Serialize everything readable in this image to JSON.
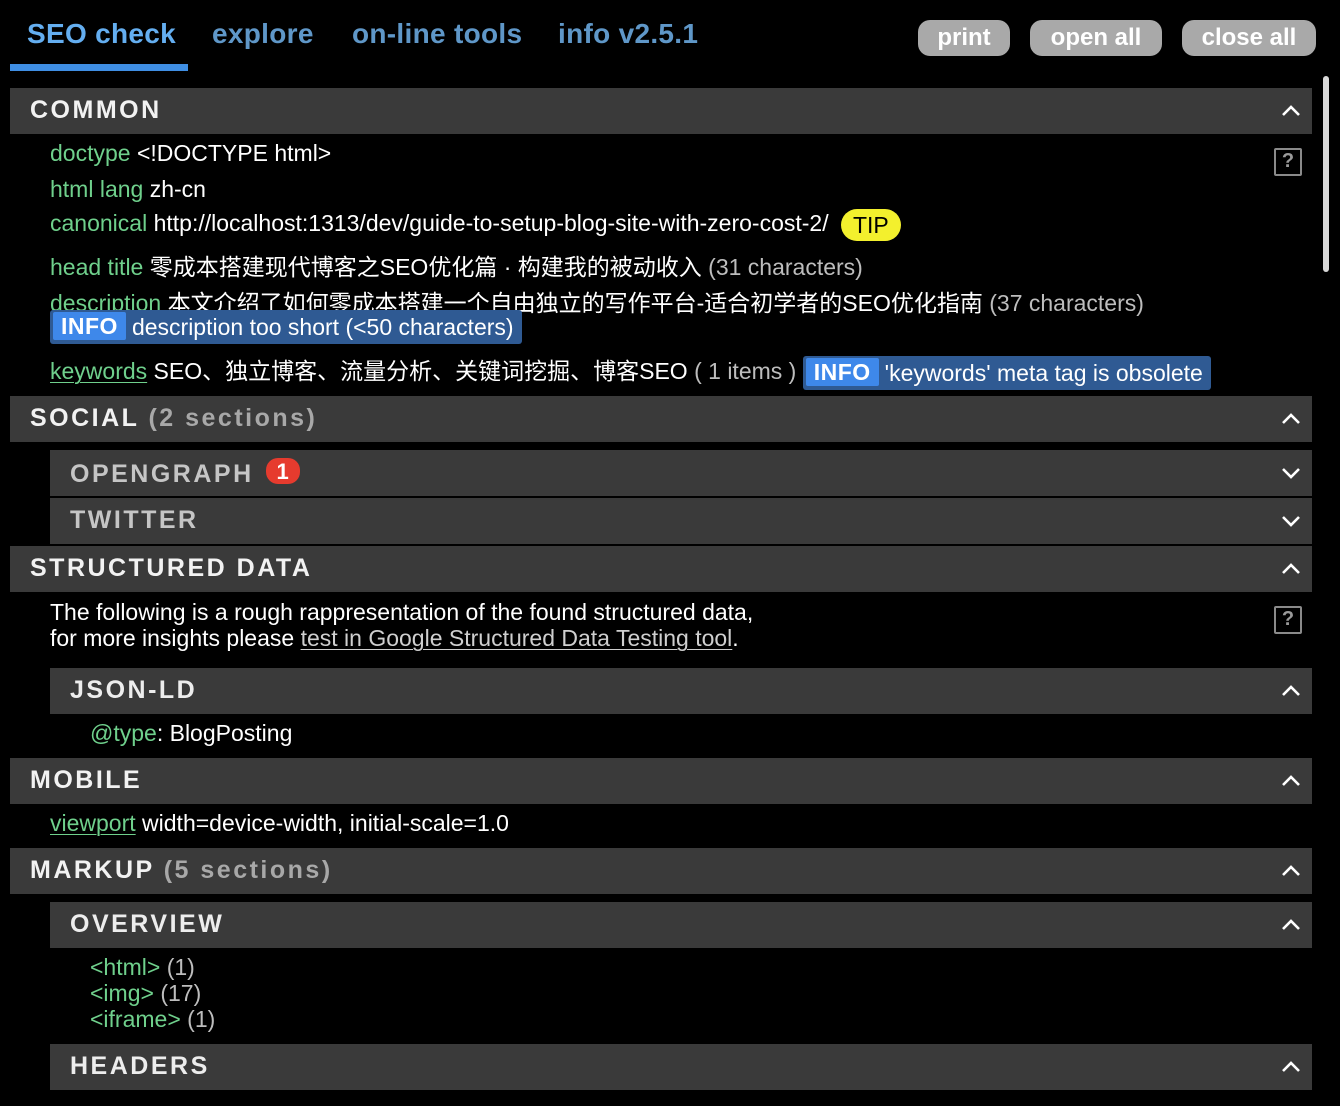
{
  "nav": {
    "tabs": [
      {
        "label": "SEO check"
      },
      {
        "label": "explore"
      },
      {
        "label": "on-line tools"
      },
      {
        "label": "info v2.5.1"
      }
    ],
    "buttons": {
      "print": "print",
      "open_all": "open all",
      "close_all": "close all"
    }
  },
  "common": {
    "title": "COMMON",
    "doctype": {
      "key": "doctype",
      "value": "<!DOCTYPE html>"
    },
    "html_lang": {
      "key": "html lang",
      "value": "zh-cn"
    },
    "canonical": {
      "key": "canonical",
      "value": "http://localhost:1313/dev/guide-to-setup-blog-site-with-zero-cost-2/",
      "badge": "TIP"
    },
    "head_title": {
      "key": "head title",
      "value": "零成本搭建现代博客之SEO优化篇 · 构建我的被动收入",
      "note": "(31 characters)"
    },
    "description": {
      "key": "description",
      "value": "本文介绍了如何零成本搭建一个自由独立的写作平台-适合初学者的SEO优化指南",
      "note": "(37 characters)",
      "info_label": "INFO",
      "info_text": "description too short (<50 characters)"
    },
    "keywords": {
      "key": "keywords",
      "value": "SEO、独立博客、流量分析、关键词挖掘、博客SEO",
      "note": "( 1 items )",
      "info_label": "INFO",
      "info_text": "'keywords' meta tag is obsolete"
    },
    "help": "?"
  },
  "social": {
    "title": "SOCIAL",
    "count": "(2 sections)",
    "opengraph": {
      "title": "OPENGRAPH",
      "badge": "1"
    },
    "twitter": {
      "title": "TWITTER"
    }
  },
  "structured": {
    "title": "STRUCTURED DATA",
    "text1": "The following is a rough rappresentation of the found structured data,",
    "text2": "for more insights please",
    "link": "test in Google Structured Data Testing tool",
    "period": ".",
    "help": "?",
    "jsonld": {
      "title": "JSON-LD",
      "key": "@type",
      "colon": ":",
      "value": "BlogPosting"
    }
  },
  "mobile": {
    "title": "MOBILE",
    "viewport": {
      "key": "viewport",
      "value": "width=device-width, initial-scale=1.0"
    }
  },
  "markup": {
    "title": "MARKUP",
    "count": "(5 sections)",
    "overview": {
      "title": "OVERVIEW",
      "items": [
        {
          "tag": "<html>",
          "count": "(1)"
        },
        {
          "tag": "<img>",
          "count": "(17)"
        },
        {
          "tag": "<iframe>",
          "count": "(1)"
        }
      ]
    },
    "headers": {
      "title": "HEADERS"
    }
  }
}
